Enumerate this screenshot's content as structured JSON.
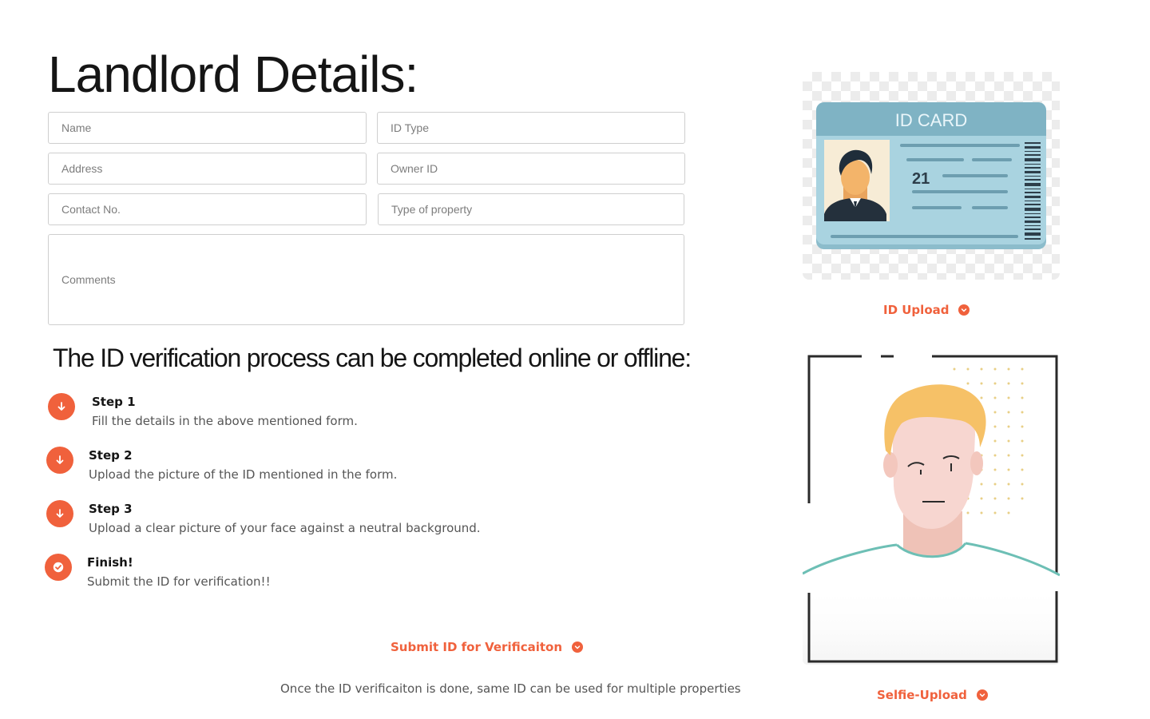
{
  "page": {
    "title": "Landlord Details:"
  },
  "form": {
    "name_placeholder": "Name",
    "id_type_placeholder": "ID Type",
    "address_placeholder": "Address",
    "owner_id_placeholder": "Owner ID",
    "contact_placeholder": "Contact No.",
    "property_type_placeholder": "Type of property",
    "comments_placeholder": "Comments"
  },
  "process": {
    "heading": "The ID verification process can be completed online or offline:",
    "steps": [
      {
        "title": "Step 1",
        "desc": "Fill the details in the above mentioned form.",
        "icon": "arrow-down-icon"
      },
      {
        "title": "Step 2",
        "desc": "Upload the picture of the ID mentioned in the form.",
        "icon": "arrow-down-icon"
      },
      {
        "title": "Step 3",
        "desc": "Upload a clear picture of your face against a neutral background.",
        "icon": "arrow-down-icon"
      },
      {
        "title": "Finish!",
        "desc": "Submit the ID for verification!!",
        "icon": "check-icon"
      }
    ]
  },
  "actions": {
    "submit_label": "Submit ID for Verificaiton",
    "id_upload_label": "ID Upload",
    "selfie_upload_label": "Selfie-Upload"
  },
  "note": "Once the ID verificaiton is done, same ID can be used for multiple properties",
  "id_card": {
    "title": "ID CARD",
    "number": "21"
  },
  "colors": {
    "accent": "#f0613c",
    "card_blue": "#a9d3e0",
    "card_header": "#7fb3c4"
  }
}
